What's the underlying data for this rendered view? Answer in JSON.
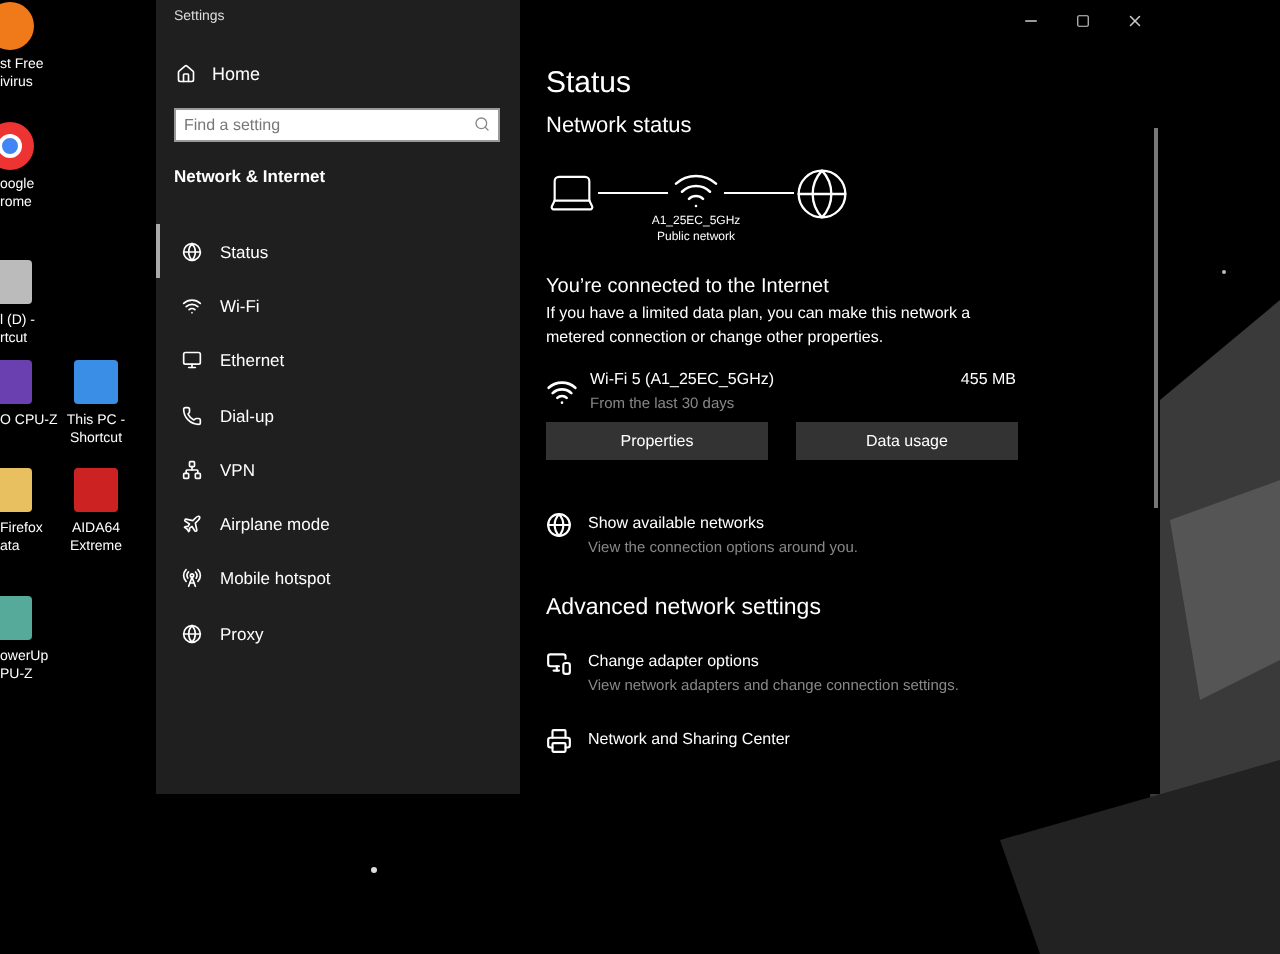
{
  "desktop_icons": [
    {
      "label": "st Free\nivirus"
    },
    {
      "label": "oogle\nrome"
    },
    {
      "label": "l (D) -\nrtcut"
    },
    {
      "label": "O CPU-Z"
    },
    {
      "label": "This PC -\nShortcut"
    },
    {
      "label": "Firefox\nata"
    },
    {
      "label": "AIDA64\nExtreme"
    },
    {
      "label": "owerUp\nPU-Z"
    }
  ],
  "window": {
    "title": "Settings"
  },
  "sidebar": {
    "home": "Home",
    "search": {
      "placeholder": "Find a setting"
    },
    "section": "Network & Internet",
    "items": [
      {
        "label": "Status",
        "selected": true
      },
      {
        "label": "Wi-Fi",
        "selected": false
      },
      {
        "label": "Ethernet",
        "selected": false
      },
      {
        "label": "Dial-up",
        "selected": false
      },
      {
        "label": "VPN",
        "selected": false
      },
      {
        "label": "Airplane mode",
        "selected": false
      },
      {
        "label": "Mobile hotspot",
        "selected": false
      },
      {
        "label": "Proxy",
        "selected": false
      }
    ]
  },
  "content": {
    "title": "Status",
    "network_status": "Network status",
    "diagram": {
      "ssid": "A1_25EC_5GHz",
      "profile": "Public network"
    },
    "connected": "You’re connected to the Internet",
    "description": "If you have a limited data plan, you can make this network a metered connection or change other properties.",
    "connection": {
      "name": "Wi-Fi 5 (A1_25EC_5GHz)",
      "period": "From the last 30 days",
      "usage": "455 MB"
    },
    "buttons": [
      "Properties",
      "Data usage"
    ],
    "show_networks": {
      "title": "Show available networks",
      "subtitle": "View the connection options around you."
    },
    "advanced_heading": "Advanced network settings",
    "advanced_items": [
      {
        "title": "Change adapter options",
        "subtitle": "View network adapters and change connection settings."
      },
      {
        "title": "Network and Sharing Center"
      }
    ]
  }
}
